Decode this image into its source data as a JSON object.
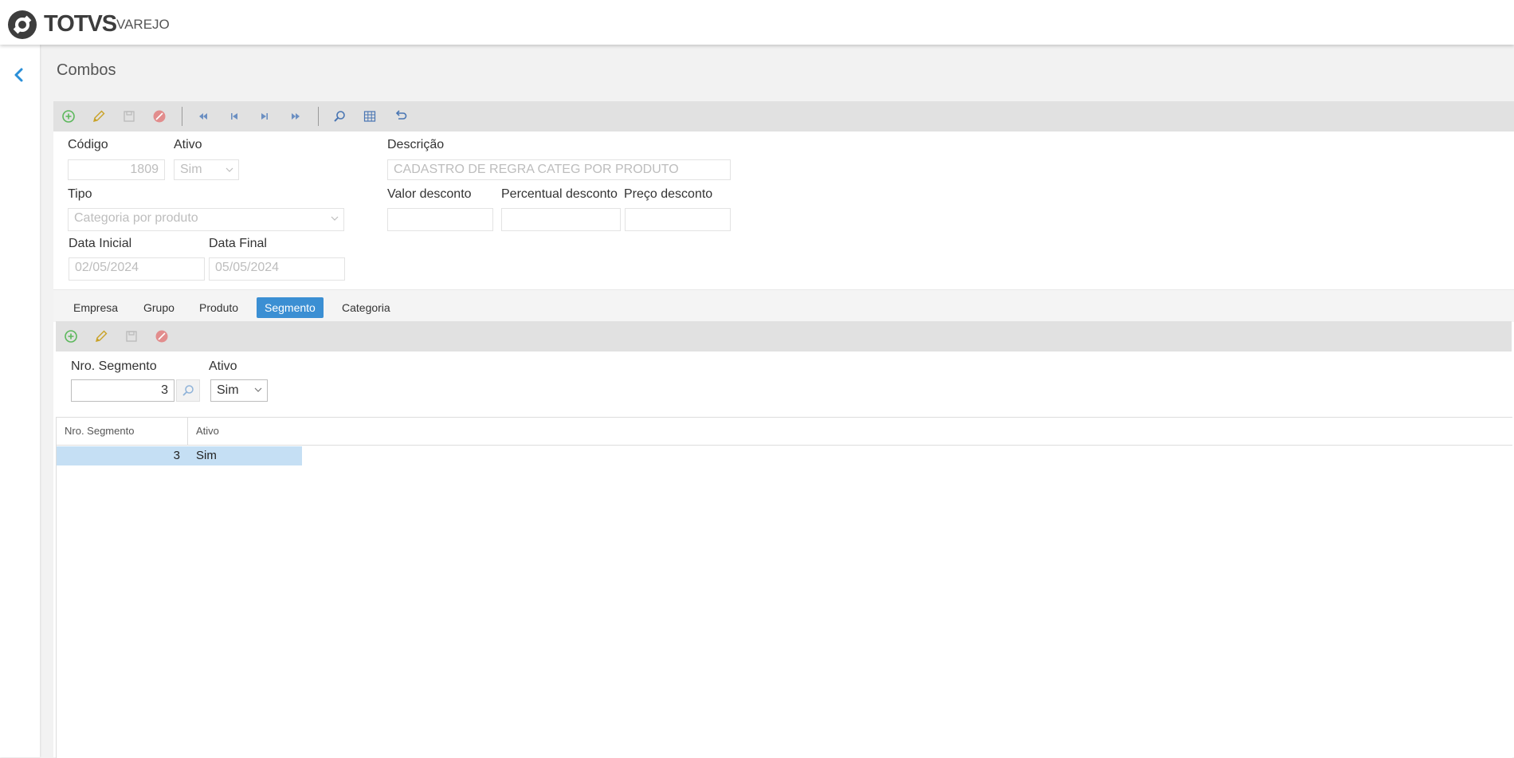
{
  "brand": {
    "name": "TOTVS",
    "sub": "VAREJO"
  },
  "page": {
    "title": "Combos"
  },
  "form": {
    "codigo": {
      "label": "Código",
      "value": "1809"
    },
    "ativo": {
      "label": "Ativo",
      "value": "Sim"
    },
    "descricao": {
      "label": "Descrição",
      "value": "CADASTRO DE REGRA CATEG POR PRODUTO"
    },
    "tipo": {
      "label": "Tipo",
      "value": "Categoria por produto"
    },
    "valor_desconto": {
      "label": "Valor desconto",
      "value": ""
    },
    "percentual_desconto": {
      "label": "Percentual desconto",
      "value": ""
    },
    "preco_desconto": {
      "label": "Preço desconto",
      "value": ""
    },
    "data_inicial": {
      "label": "Data Inicial",
      "value": "02/05/2024"
    },
    "data_final": {
      "label": "Data Final",
      "value": "05/05/2024"
    }
  },
  "tabs": [
    {
      "label": "Empresa"
    },
    {
      "label": "Grupo"
    },
    {
      "label": "Produto"
    },
    {
      "label": "Segmento",
      "active": true
    },
    {
      "label": "Categoria"
    }
  ],
  "segment_form": {
    "nro_segmento": {
      "label": "Nro. Segmento",
      "value": "3"
    },
    "ativo": {
      "label": "Ativo",
      "value": "Sim"
    }
  },
  "grid": {
    "columns": [
      "Nro. Segmento",
      "Ativo"
    ],
    "rows": [
      {
        "nro_segmento": "3",
        "ativo": "Sim"
      }
    ]
  },
  "colors": {
    "accent": "#3b8fd3",
    "selected_row": "#c5dff4",
    "toolbar_bg": "#e1e1e1",
    "add_icon": "#5cb85c",
    "edit_icon": "#c9a227",
    "cancel_icon": "#e26a6a"
  },
  "icons": {
    "toolbar": [
      "add-icon",
      "edit-icon",
      "save-icon",
      "cancel-icon",
      "first-record-icon",
      "previous-record-icon",
      "next-record-icon",
      "last-record-icon",
      "search-icon",
      "grid-icon",
      "undo-icon"
    ],
    "sub_toolbar": [
      "add-icon",
      "edit-icon",
      "save-icon",
      "cancel-icon"
    ]
  }
}
